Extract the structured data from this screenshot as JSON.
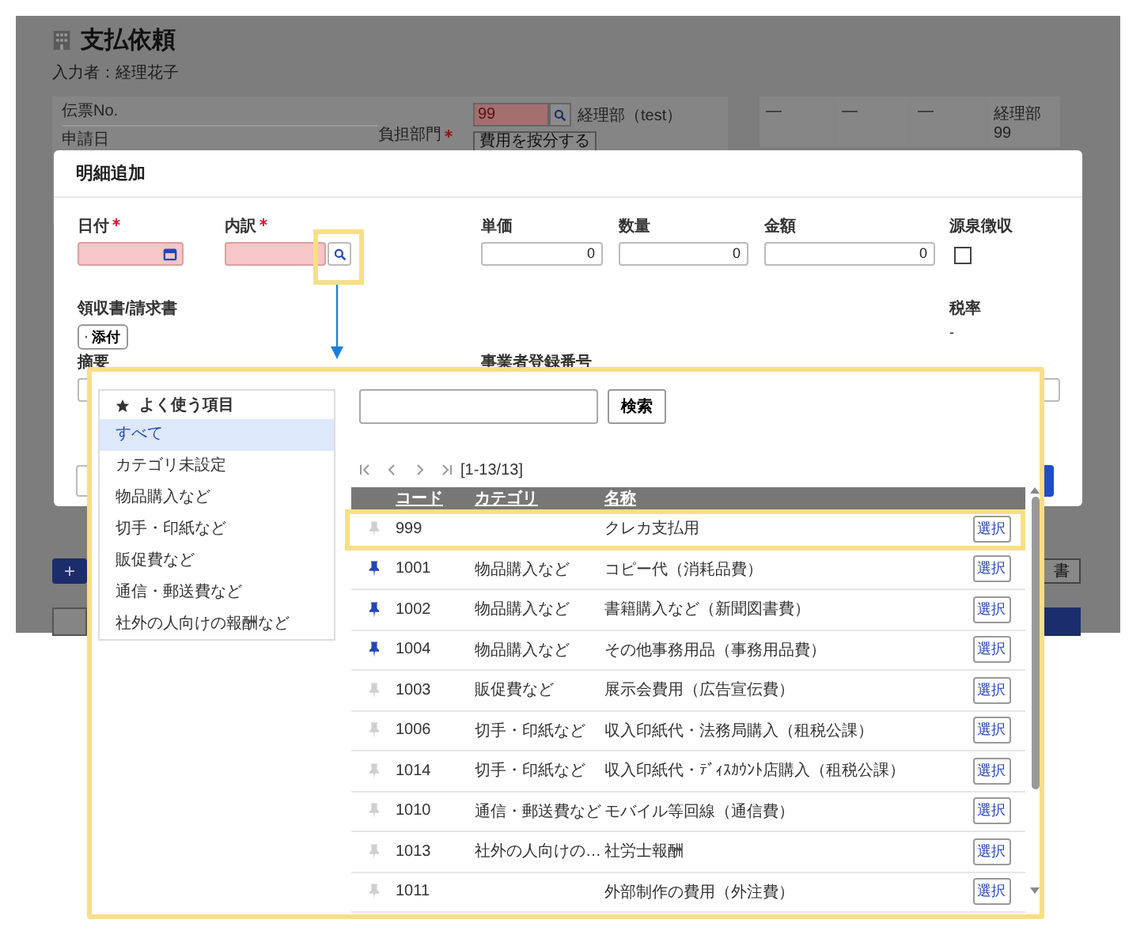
{
  "page": {
    "title": "支払依頼",
    "author": "入力者：経理花子"
  },
  "header_form": {
    "voucher_label": "伝票No.",
    "date_label": "申請日",
    "dept_label": "負担部門",
    "dept_required": true,
    "dept_code": "99",
    "dept_name": "経理部（test）",
    "split_button": "費用を按分する",
    "summary": [
      "—",
      "—",
      "—"
    ],
    "summary_dept": "経理部",
    "summary_code": "99"
  },
  "dialog": {
    "title": "明細追加",
    "fields": [
      {
        "kind": "date",
        "label": "日付",
        "required": true
      },
      {
        "kind": "lookup",
        "label": "内訳",
        "required": true
      },
      {
        "kind": "number",
        "label": "単価",
        "required": false,
        "value": "0"
      },
      {
        "kind": "number",
        "label": "数量",
        "required": false,
        "value": "0"
      },
      {
        "kind": "number",
        "label": "金額",
        "required": false,
        "value": "0"
      },
      {
        "kind": "checkbox",
        "label": "源泉徴収",
        "required": false,
        "checked": false
      }
    ],
    "attachment_label": "領収書/請求書",
    "attach_button": "添付",
    "tax_label": "税率",
    "tax_value": "-",
    "memo_label": "摘要",
    "registration_label": "事業者登録番号"
  },
  "background_buttons": {
    "add": "+",
    "document": "書"
  },
  "picker": {
    "favorites_label": "よく使う項目",
    "categories": [
      {
        "label": "すべて",
        "selected": true
      },
      {
        "label": "カテゴリ未設定",
        "selected": false
      },
      {
        "label": "物品購入など",
        "selected": false
      },
      {
        "label": "切手・印紙など",
        "selected": false
      },
      {
        "label": "販促費など",
        "selected": false
      },
      {
        "label": "通信・郵送費など",
        "selected": false
      },
      {
        "label": "社外の人向けの報酬など",
        "selected": false
      }
    ],
    "search_button": "検索",
    "pager": "[1-13/13]",
    "columns": [
      "コード",
      "カテゴリ",
      "名称"
    ],
    "rows": [
      {
        "pinned": false,
        "highlighted": true,
        "code": "999",
        "name": "クレカ支払用",
        "action": "選択"
      },
      {
        "pinned": true,
        "highlighted": false,
        "code": "1001",
        "category": "物品購入など",
        "name": "コピー代（消耗品費）",
        "action": "選択"
      },
      {
        "pinned": true,
        "highlighted": false,
        "code": "1002",
        "category": "物品購入など",
        "name": "書籍購入など（新聞図書費）",
        "action": "選択"
      },
      {
        "pinned": true,
        "highlighted": false,
        "code": "1004",
        "category": "物品購入など",
        "name": "その他事務用品（事務用品費）",
        "action": "選択"
      },
      {
        "pinned": false,
        "highlighted": false,
        "code": "1003",
        "category": "販促費など",
        "name": "展示会費用（広告宣伝費）",
        "action": "選択"
      },
      {
        "pinned": false,
        "highlighted": false,
        "code": "1006",
        "category": "切手・印紙など",
        "name": "収入印紙代・法務局購入（租税公課）",
        "action": "選択"
      },
      {
        "pinned": false,
        "highlighted": false,
        "code": "1014",
        "category": "切手・印紙など",
        "name": "収入印紙代・ﾃﾞｨｽｶｳﾝﾄ店購入（租税公課）",
        "action": "選択"
      },
      {
        "pinned": false,
        "highlighted": false,
        "code": "1010",
        "category": "通信・郵送費など",
        "name": "モバイル等回線（通信費）",
        "action": "選択"
      },
      {
        "pinned": false,
        "highlighted": false,
        "code": "1013",
        "category": "社外の人向けの…",
        "name": "社労士報酬",
        "action": "選択"
      },
      {
        "pinned": false,
        "highlighted": false,
        "code": "1011",
        "name": "外部制作の費用（外注費）",
        "action": "選択"
      }
    ]
  }
}
